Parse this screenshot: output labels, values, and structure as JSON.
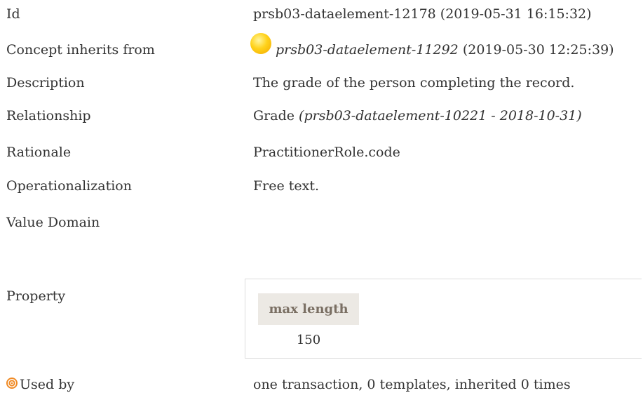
{
  "rows": {
    "id": {
      "label": "Id",
      "value": "prsb03-dataelement-12178 (2019-05-31 16:15:32)"
    },
    "inherits": {
      "label": "Concept inherits from",
      "ref": "prsb03-dataelement-11292",
      "date": " (2019-05-30 12:25:39)",
      "icon": "yellow-ball-icon"
    },
    "description": {
      "label": "Description",
      "value": "The grade of the person completing the record."
    },
    "relationship": {
      "label": "Relationship",
      "name": "Grade ",
      "ref": "(prsb03-dataelement-10221 - 2018-10-31)"
    },
    "rationale": {
      "label": "Rationale",
      "value": "PractitionerRole.code"
    },
    "operationalization": {
      "label": "Operationalization",
      "value": "Free text."
    },
    "value_domain": {
      "label": "Value Domain"
    },
    "property": {
      "label": "Property",
      "column_header": "max length",
      "column_value": "150"
    },
    "used_by": {
      "label": "Used by",
      "icon": "target-icon",
      "value": "one transaction, 0 templates, inherited 0 times"
    }
  },
  "colors": {
    "text": "#333333",
    "header_bg": "#ece9e4",
    "header_text": "#7a6f63",
    "target_icon": "#f08a24"
  }
}
